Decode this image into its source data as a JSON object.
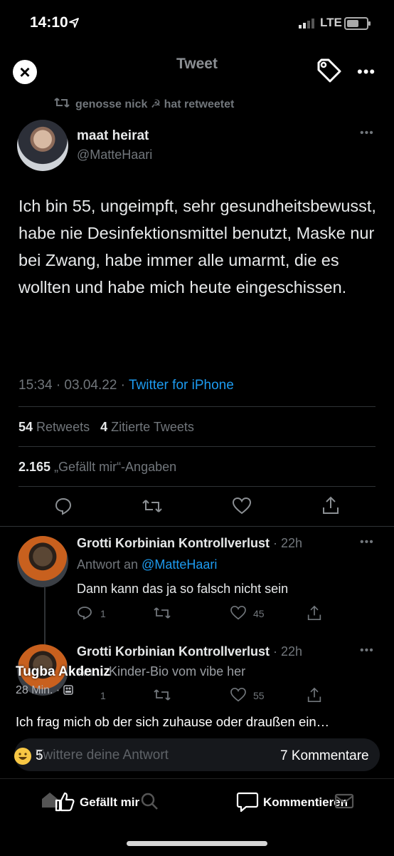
{
  "status_bar": {
    "time": "14:10",
    "network": "LTE"
  },
  "header": {
    "title": "Tweet",
    "more": "•••"
  },
  "retweet_label": "genosse nick ☭ hat retweetet",
  "tweet": {
    "display_name": "maat heirat",
    "handle": "@MatteHaari",
    "text": "Ich bin 55, ungeimpft, sehr gesundheitsbewusst, habe nie Desinfektionsmittel benutzt, Maske nur bei Zwang, habe immer alle umarmt, die es wollten und habe mich heute eingeschissen.",
    "timestamp": "15:34 · 03.04.22 · ",
    "source": "Twitter for iPhone",
    "retweets_count": "54",
    "retweets_label": "Retweets",
    "quotes_count": "4",
    "quotes_label": "Zitierte Tweets",
    "likes_count": "2.165",
    "likes_label": "„Gefällt mir“-Angaben"
  },
  "replies": [
    {
      "name": "Grotti Korbinian Kontrollverlust",
      "ago": " · 22h",
      "reply_prefix": "Antwort an ",
      "reply_to": "@MatteHaari",
      "text": "Dann kann das ja so falsch nicht sein",
      "reply_count": "1",
      "like_count": "45"
    },
    {
      "name": "Grotti Korbinian Kontrollverlust",
      "ago": " · 22h",
      "text": "An… Kinder-Bio vom vibe her",
      "reply_count": "1",
      "like_count": "55"
    }
  ],
  "overlay": {
    "commenter_name": "Tugba Akdeniz",
    "comment_time": "28 Min. ·",
    "comment_text": "Ich frag mich ob der sich zuhause oder draußen ein…",
    "compose_placeholder": "Twittere deine Antwort",
    "reaction_count": "5",
    "comments_count": "7 Kommentare",
    "like_label": "Gefällt mir",
    "comment_label": "Kommentieren"
  },
  "colors": {
    "link": "#1d9bf0",
    "muted": "#71767b",
    "background": "#000000"
  }
}
